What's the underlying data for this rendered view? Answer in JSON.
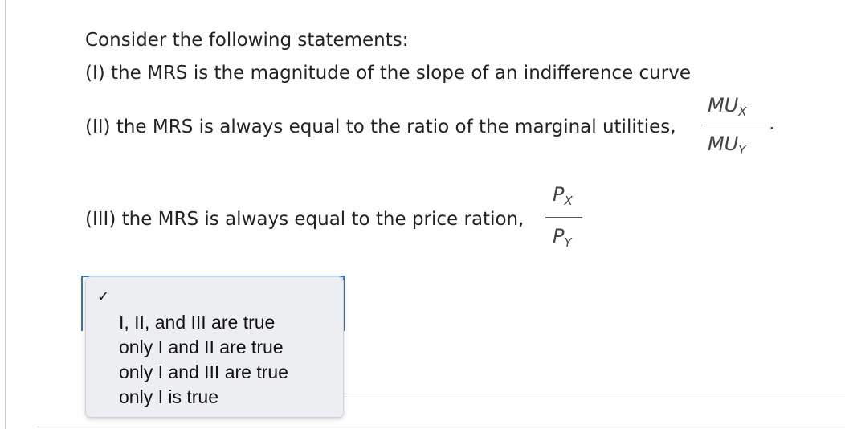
{
  "question": {
    "intro": "Consider the following statements:",
    "statement_1": "(I) the MRS is the magnitude of the slope of an indifference curve",
    "statement_2": "(II) the MRS is always equal to the ratio of the marginal utilities,",
    "statement_3": "(III) the MRS is always equal to the price ration,",
    "fraction_mu": {
      "num": "MU",
      "num_sub": "X",
      "den": "MU",
      "den_sub": "Y",
      "trailing": "."
    },
    "fraction_p": {
      "num": "P",
      "num_sub": "X",
      "den": "P",
      "den_sub": "Y"
    }
  },
  "dropdown": {
    "selected_mark": "✓",
    "options": [
      "I, II, and III are true",
      "only I and II are true",
      "only I and III are true",
      "only I is true"
    ]
  }
}
